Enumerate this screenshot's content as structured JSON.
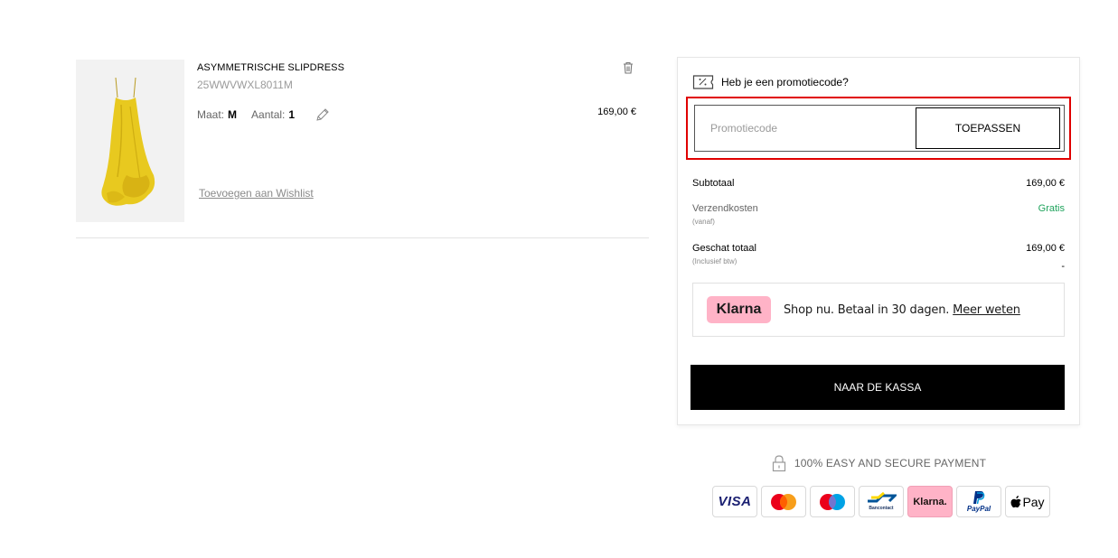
{
  "cart_item": {
    "name": "ASYMMETRISCHE SLIPDRESS",
    "reference": "25WWVWXL8011M",
    "size_label": "Maat:",
    "size_value": "M",
    "quantity_label": "Aantal:",
    "quantity_value": "1",
    "price": "169,00 €",
    "wishlist_link": "Toevoegen aan Wishlist",
    "image_alt": "yellow dress"
  },
  "promo": {
    "heading": "Heb je een promotiecode?",
    "placeholder": "Promotiecode",
    "value": "",
    "apply_label": "TOEPASSEN"
  },
  "summary": {
    "subtotal_label": "Subtotaal",
    "subtotal_value": "169,00 €",
    "shipping_label": "Verzendkosten",
    "shipping_sub": "(vanaf)",
    "shipping_value": "Gratis",
    "total_label": "Geschat totaal",
    "total_sub": "(Inclusief btw)",
    "total_value": "169,00 €",
    "vat_value": "-"
  },
  "klarna": {
    "badge": "Klarna",
    "text": "Shop nu. Betaal in 30 dagen.",
    "link": "Meer weten"
  },
  "checkout_label": "NAAR DE KASSA",
  "secure_text": "100% EASY AND  SECURE PAYMENT",
  "payment_methods": [
    {
      "name": "visa",
      "label": "VISA"
    },
    {
      "name": "mastercard",
      "label": ""
    },
    {
      "name": "maestro",
      "label": ""
    },
    {
      "name": "bancontact",
      "label": "Bancontact"
    },
    {
      "name": "klarna",
      "label": "Klarna."
    },
    {
      "name": "paypal",
      "label": "PayPal"
    },
    {
      "name": "apple-pay",
      "label": "Pay"
    }
  ],
  "colors": {
    "highlight": "#e00000",
    "gratis": "#1fa35c",
    "klarna_pink": "#ffb3c7",
    "checkout_bg": "#000000"
  },
  "icons": [
    "trash-icon",
    "pencil-icon",
    "ticket-icon",
    "lock-icon"
  ]
}
